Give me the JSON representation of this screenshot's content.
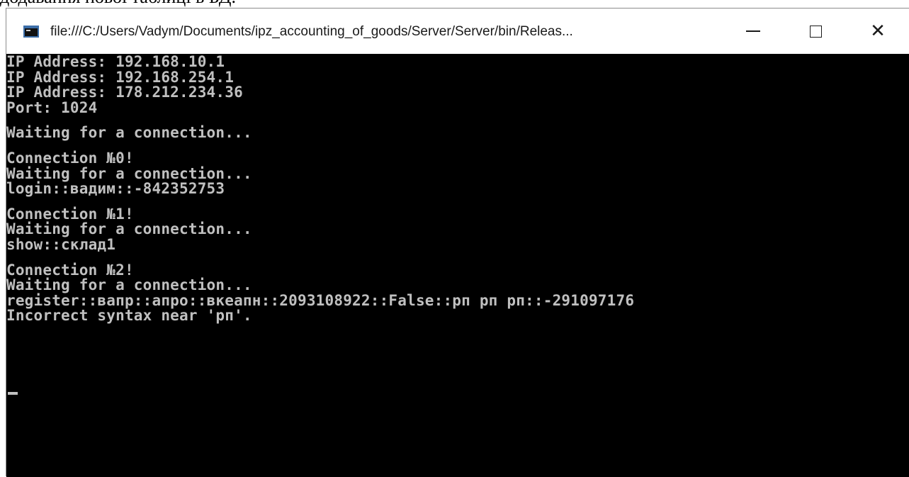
{
  "caption": "додавання нової таблиці в БД.",
  "window": {
    "title": "file:///C:/Users/Vadym/Documents/ipz_accounting_of_goods/Server/Server/bin/Releas...",
    "minimize_glyph": "—",
    "maximize_glyph": "☐",
    "close_glyph": "✕"
  },
  "console": {
    "fg_color": "#c0c0c0",
    "bg_color": "#000000",
    "blocks": [
      [
        "IP Address: 192.168.10.1",
        "IP Address: 192.168.254.1",
        "IP Address: 178.212.234.36",
        "Port: 1024"
      ],
      [
        "Waiting for a connection..."
      ],
      [
        "Connection №0!",
        "Waiting for a connection...",
        "login::вадим::-842352753"
      ],
      [
        "Connection №1!",
        "Waiting for a connection...",
        "show::склад1"
      ],
      [
        "Connection №2!",
        "Waiting for a connection...",
        "register::вапр::апро::вкеапн::2093108922::False::рп рп рп::-291097176",
        "Incorrect syntax near 'рп'."
      ]
    ]
  }
}
